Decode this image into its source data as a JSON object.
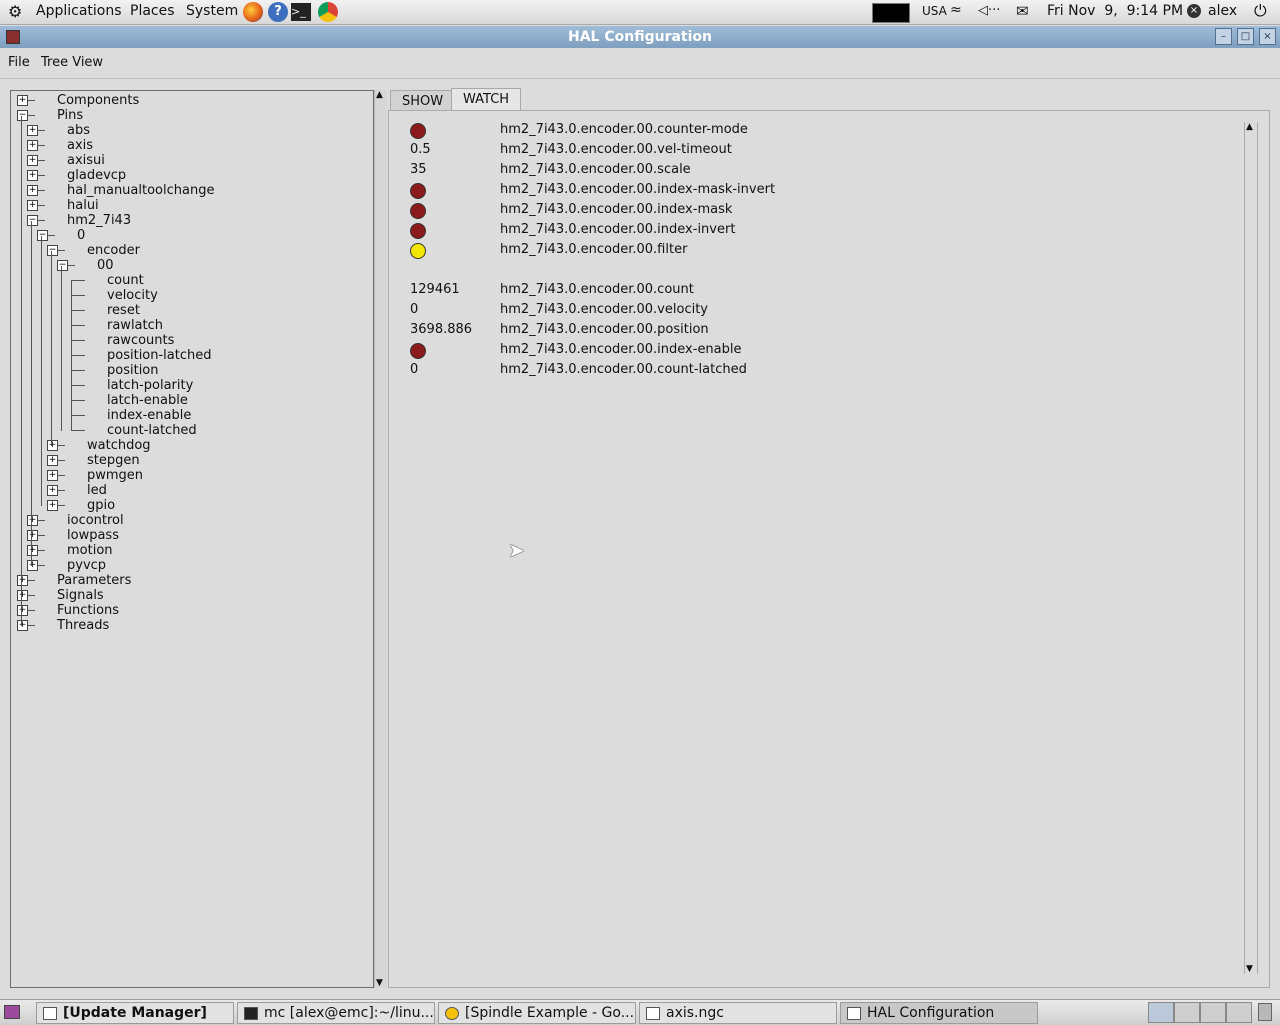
{
  "top_panel": {
    "menus": [
      "Applications",
      "Places",
      "System"
    ],
    "keyboard": "USA",
    "clock": "Fri Nov  9,  9:14 PM",
    "user": "alex"
  },
  "window": {
    "title": "HAL Configuration",
    "menu": [
      "File",
      "Tree View"
    ]
  },
  "tree": {
    "rows": [
      {
        "label": "Components"
      },
      {
        "label": "Pins"
      },
      {
        "label": "abs"
      },
      {
        "label": "axis"
      },
      {
        "label": "axisui"
      },
      {
        "label": "gladevcp"
      },
      {
        "label": "hal_manualtoolchange"
      },
      {
        "label": "halui"
      },
      {
        "label": "hm2_7i43"
      },
      {
        "label": "0"
      },
      {
        "label": "encoder"
      },
      {
        "label": "00"
      },
      {
        "label": "count"
      },
      {
        "label": "velocity"
      },
      {
        "label": "reset"
      },
      {
        "label": "rawlatch"
      },
      {
        "label": "rawcounts"
      },
      {
        "label": "position-latched"
      },
      {
        "label": "position"
      },
      {
        "label": "latch-polarity"
      },
      {
        "label": "latch-enable"
      },
      {
        "label": "index-enable"
      },
      {
        "label": "count-latched"
      },
      {
        "label": "watchdog"
      },
      {
        "label": "stepgen"
      },
      {
        "label": "pwmgen"
      },
      {
        "label": "led"
      },
      {
        "label": "gpio"
      },
      {
        "label": "iocontrol"
      },
      {
        "label": "lowpass"
      },
      {
        "label": "motion"
      },
      {
        "label": "pyvcp"
      },
      {
        "label": "Parameters"
      },
      {
        "label": "Signals"
      },
      {
        "label": "Functions"
      },
      {
        "label": "Threads"
      }
    ]
  },
  "tabs": [
    "SHOW",
    "WATCH"
  ],
  "watch": [
    {
      "value": "",
      "led": "off",
      "name": "hm2_7i43.0.encoder.00.counter-mode"
    },
    {
      "value": "0.5",
      "led": null,
      "name": "hm2_7i43.0.encoder.00.vel-timeout"
    },
    {
      "value": "35",
      "led": null,
      "name": "hm2_7i43.0.encoder.00.scale"
    },
    {
      "value": "",
      "led": "off",
      "name": "hm2_7i43.0.encoder.00.index-mask-invert"
    },
    {
      "value": "",
      "led": "off",
      "name": "hm2_7i43.0.encoder.00.index-mask"
    },
    {
      "value": "",
      "led": "off",
      "name": "hm2_7i43.0.encoder.00.index-invert"
    },
    {
      "value": "",
      "led": "on",
      "name": "hm2_7i43.0.encoder.00.filter"
    },
    {
      "value": "129461",
      "led": null,
      "name": "hm2_7i43.0.encoder.00.count"
    },
    {
      "value": "0",
      "led": null,
      "name": "hm2_7i43.0.encoder.00.velocity"
    },
    {
      "value": "3698.886",
      "led": null,
      "name": "hm2_7i43.0.encoder.00.position"
    },
    {
      "value": "",
      "led": "off",
      "name": "hm2_7i43.0.encoder.00.index-enable"
    },
    {
      "value": "0",
      "led": null,
      "name": "hm2_7i43.0.encoder.00.count-latched"
    }
  ],
  "colors": {
    "led_off": "#8b1a1a",
    "led_on": "#f2e600"
  },
  "taskbar": [
    {
      "label": "[Update Manager]"
    },
    {
      "label": "mc [alex@emc]:~/linu..."
    },
    {
      "label": "[Spindle Example - Go..."
    },
    {
      "label": "axis.ngc"
    },
    {
      "label": "HAL Configuration"
    }
  ]
}
